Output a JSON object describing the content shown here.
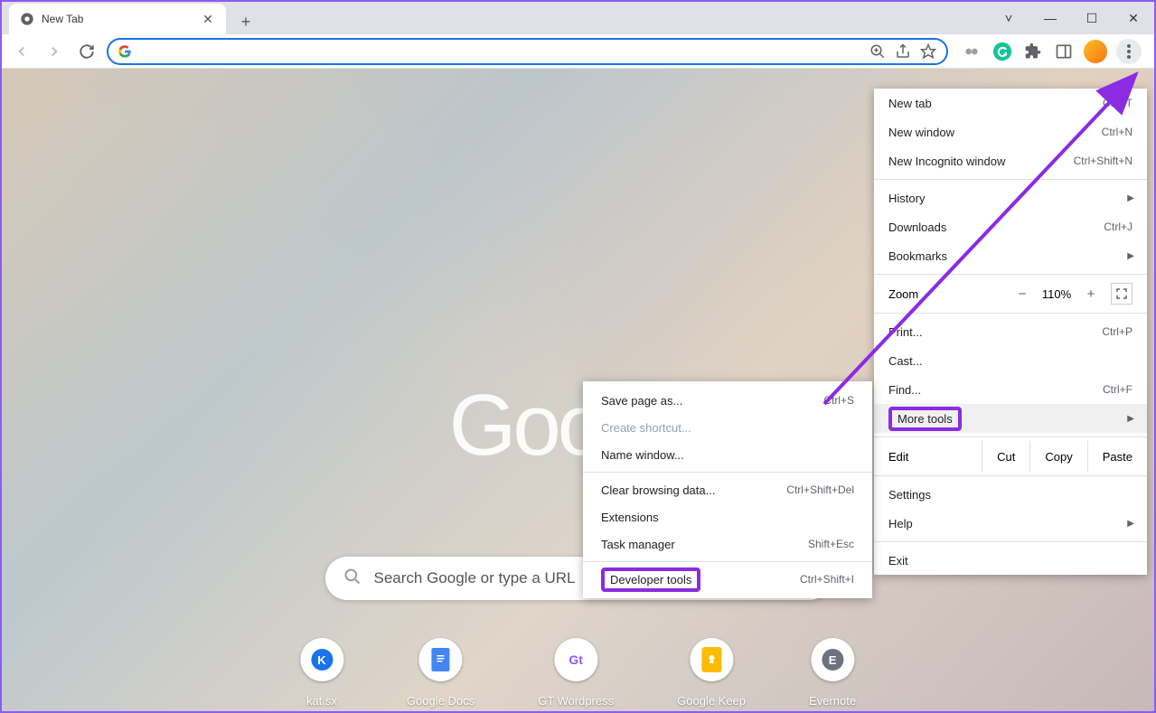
{
  "window": {
    "tab_title": "New Tab"
  },
  "search": {
    "placeholder": "Search Google or type a URL"
  },
  "shortcuts": [
    {
      "label": "kat.sx",
      "letter": "K",
      "bg": "#1a73e8"
    },
    {
      "label": "Google Docs",
      "letter": "",
      "bg": "#4285f4"
    },
    {
      "label": "GT Wordpress",
      "letter": "Gt",
      "bg": "#8b5cf6"
    },
    {
      "label": "Google Keep",
      "letter": "",
      "bg": "#fbbc04"
    },
    {
      "label": "Evernote",
      "letter": "E",
      "bg": "#6b7280"
    }
  ],
  "main_menu": {
    "new_tab": {
      "label": "New tab",
      "shortcut": "Ctrl+T"
    },
    "new_window": {
      "label": "New window",
      "shortcut": "Ctrl+N"
    },
    "new_incognito": {
      "label": "New Incognito window",
      "shortcut": "Ctrl+Shift+N"
    },
    "history": {
      "label": "History"
    },
    "downloads": {
      "label": "Downloads",
      "shortcut": "Ctrl+J"
    },
    "bookmarks": {
      "label": "Bookmarks"
    },
    "zoom": {
      "label": "Zoom",
      "value": "110%"
    },
    "print": {
      "label": "Print...",
      "shortcut": "Ctrl+P"
    },
    "cast": {
      "label": "Cast..."
    },
    "find": {
      "label": "Find...",
      "shortcut": "Ctrl+F"
    },
    "more_tools": {
      "label": "More tools"
    },
    "edit": {
      "label": "Edit",
      "cut": "Cut",
      "copy": "Copy",
      "paste": "Paste"
    },
    "settings": {
      "label": "Settings"
    },
    "help": {
      "label": "Help"
    },
    "exit": {
      "label": "Exit"
    }
  },
  "sub_menu": {
    "save_page": {
      "label": "Save page as...",
      "shortcut": "Ctrl+S"
    },
    "create_shortcut": {
      "label": "Create shortcut..."
    },
    "name_window": {
      "label": "Name window..."
    },
    "clear_browsing": {
      "label": "Clear browsing data...",
      "shortcut": "Ctrl+Shift+Del"
    },
    "extensions": {
      "label": "Extensions"
    },
    "task_manager": {
      "label": "Task manager",
      "shortcut": "Shift+Esc"
    },
    "developer_tools": {
      "label": "Developer tools",
      "shortcut": "Ctrl+Shift+I"
    }
  }
}
